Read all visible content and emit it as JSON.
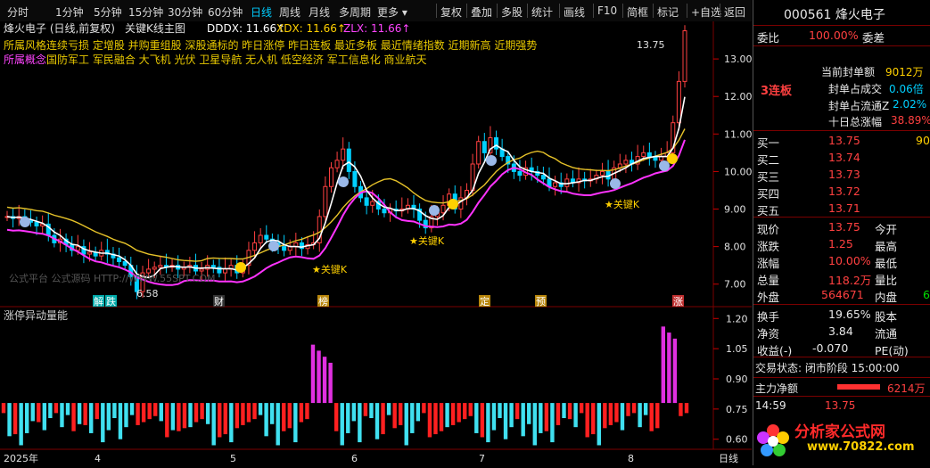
{
  "toolbar": {
    "periods": [
      "分时",
      "1分钟",
      "5分钟",
      "15分钟",
      "30分钟",
      "60分钟",
      "日线",
      "周线",
      "月线",
      "多周期",
      "更多"
    ],
    "active_period": "日线",
    "tools": [
      "复权",
      "叠加",
      "多股",
      "统计",
      "画线",
      "F10",
      "简框",
      "标记",
      "+自选",
      "返回"
    ]
  },
  "chart": {
    "stock_label": "烽火电子 (日线,前复权)",
    "indicator_name": "关键K线主图",
    "dddx": "DDDX: 11.66↑",
    "xdx": "XDX: 11.66↑",
    "zlx": "ZLX: 11.66↑",
    "concepts_label": "所属风格",
    "concepts_line1": "连续亏损  定增股  并购重组股  深股通标的  昨日涨停  昨日连板  最近多板  最近情绪指数  近期新高  近期强势",
    "sector_label": "所属概念",
    "concepts_line2": "国防军工  军民融合  大飞机  光伏  卫星导航  无人机  低空经济  军工信息化  商业航天",
    "high_label": "13.75",
    "low_label": "6.58",
    "key_k_label": "关键K",
    "watermark": "公式平台 公式源码 HTTP://WWW.55SPT.COM",
    "event_labels": [
      "解",
      "跌",
      "财",
      "榜",
      "定",
      "预",
      "涨"
    ],
    "lower_title": "涨停异动量能",
    "bottom_labels": [
      "2025年",
      "4",
      "5",
      "6",
      "7",
      "8"
    ],
    "bottom_right": "日线"
  },
  "chart_data": [
    {
      "type": "line",
      "name": "price-panel",
      "yaxis_ticks": [
        7.0,
        8.0,
        9.0,
        10.0,
        11.0,
        12.0,
        13.0
      ],
      "ylim": [
        6.4,
        14.0
      ],
      "candles_close": [
        8.8,
        8.75,
        8.8,
        8.7,
        8.65,
        8.55,
        8.6,
        8.3,
        8.1,
        8.2,
        8.05,
        7.9,
        8.0,
        7.8,
        7.85,
        7.75,
        7.9,
        7.8,
        7.7,
        7.6,
        7.5,
        7.2,
        6.8,
        7.3,
        7.4,
        7.45,
        7.5,
        7.45,
        7.5,
        7.4,
        7.45,
        7.5,
        7.35,
        7.4,
        7.5,
        7.45,
        7.3,
        7.4,
        7.5,
        7.3,
        7.5,
        7.9,
        8.1,
        8.3,
        8.2,
        8.1,
        8.0,
        7.9,
        8.0,
        8.1,
        7.95,
        8.05,
        8.1,
        8.8,
        9.6,
        10.1,
        10.3,
        10.6,
        10.0,
        9.6,
        9.3,
        9.1,
        9.2,
        9.0,
        8.9,
        9.0,
        8.95,
        9.0,
        9.1,
        9.0,
        8.7,
        8.5,
        8.8,
        8.9,
        9.1,
        9.4,
        9.0,
        9.3,
        9.5,
        10.2,
        10.8,
        10.5,
        10.9,
        10.6,
        10.4,
        10.2,
        10.0,
        9.9,
        10.1,
        10.0,
        9.9,
        9.8,
        9.6,
        9.7,
        9.6,
        9.8,
        9.7,
        9.8,
        9.75,
        9.8,
        9.9,
        10.0,
        9.8,
        10.1,
        10.2,
        10.3,
        10.2,
        10.4,
        10.5,
        10.4,
        10.3,
        10.4,
        10.5,
        11.3,
        12.4,
        13.75
      ],
      "series": []
    },
    {
      "type": "bar",
      "name": "volume-energy-panel",
      "yaxis_ticks": [
        0.6,
        0.75,
        0.9,
        1.05,
        1.2
      ],
      "ylim": [
        0.55,
        1.25
      ]
    }
  ],
  "quote": {
    "code_name": "000561 烽火电子",
    "weibi_label": "委比",
    "weibi_value": "100.00%",
    "weicha_label": "委差",
    "lianban": "3连板",
    "seal_amount_label": "当前封单额",
    "seal_amount": "9012万",
    "seal_ratio_label": "封单占成交",
    "seal_ratio": "0.06倍",
    "seal_float_label": "封单占流通Z",
    "seal_float": "2.02%",
    "ten_day_label": "十日总涨幅",
    "ten_day": "38.89%",
    "bids": [
      {
        "label": "买一",
        "price": "13.75",
        "vol": "90"
      },
      {
        "label": "买二",
        "price": "13.74",
        "vol": ""
      },
      {
        "label": "买三",
        "price": "13.73",
        "vol": ""
      },
      {
        "label": "买四",
        "price": "13.72",
        "vol": ""
      },
      {
        "label": "买五",
        "price": "13.71",
        "vol": ""
      }
    ],
    "stats": [
      {
        "l1": "现价",
        "v1": "13.75",
        "l2": "今开",
        "v2": ""
      },
      {
        "l1": "涨跌",
        "v1": "1.25",
        "l2": "最高",
        "v2": ""
      },
      {
        "l1": "涨幅",
        "v1": "10.00%",
        "l2": "最低",
        "v2": ""
      },
      {
        "l1": "总量",
        "v1": "118.2万",
        "l2": "量比",
        "v2": ""
      },
      {
        "l1": "外盘",
        "v1": "564671",
        "l2": "内盘",
        "v2": "6"
      }
    ],
    "stats2": [
      {
        "l1": "换手",
        "v1": "19.65%",
        "l2": "股本"
      },
      {
        "l1": "净资",
        "v1": "3.84",
        "l2": "流通"
      },
      {
        "l1": "收益(-)",
        "v1": "-0.070",
        "l2": "PE(动)"
      }
    ],
    "trade_status": "交易状态: 闭市阶段 15:00:00",
    "main_net_label": "主力净额",
    "main_net_value": "6214万",
    "tick_time": "14:59",
    "tick_price": "13.75",
    "brand": "分析家公式网",
    "brand_url": "www.70822.com"
  },
  "colors": {
    "up": "#ff4040",
    "down": "#00d0ff",
    "ma_white": "#ffffff",
    "ma_magenta": "#ff33ff",
    "ma_yellow": "#e6c229",
    "bar_up": "#ff2020",
    "bar_down": "#40e0f0",
    "bar_magenta": "#e030e0"
  }
}
